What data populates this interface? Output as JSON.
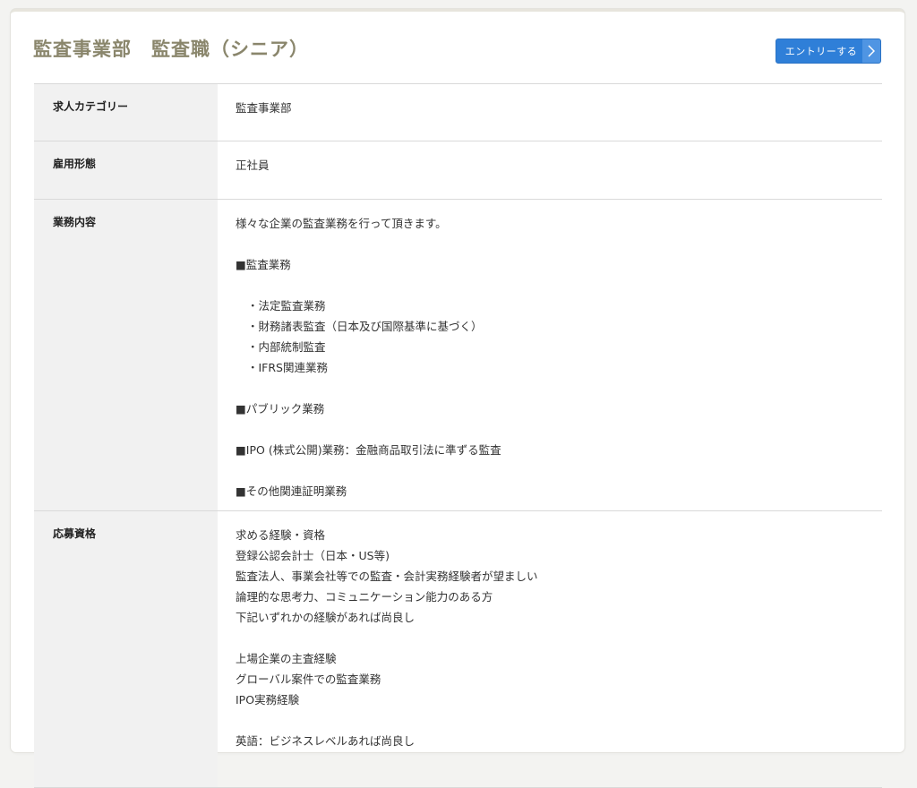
{
  "page": {
    "title": "監査事業部　監査職（シニア）",
    "entry_button_label": "エントリーする",
    "accent_color": "#2f7fd8",
    "title_color": "#8a866c"
  },
  "rows": [
    {
      "label": "求人カテゴリー",
      "value": "監査事業部"
    },
    {
      "label": "雇用形態",
      "value": "正社員"
    },
    {
      "label": "業務内容",
      "intro": "様々な企業の監査業務を行って頂きます。",
      "section1": "■監査業務",
      "items": [
        "・法定監査業務",
        "・財務諸表監査（日本及び国際基準に基づく）",
        "・内部統制監査",
        "・IFRS関連業務"
      ],
      "section2": "■パブリック業務",
      "section3": "■IPO (株式公開)業務：金融商品取引法に準ずる監査",
      "section4": "■その他関連証明業務"
    },
    {
      "label": "応募資格",
      "lines": [
        "求める経験・資格",
        "登録公認会計士（日本・US等)",
        "監査法人、事業会社等での監査・会計実務経験者が望ましい",
        "論理的な思考力、コミュニケーション能力のある方",
        "下記いずれかの経験があれば尚良し"
      ],
      "lines2": [
        "上場企業の主査経験",
        "グローバル案件での監査業務",
        "IPO実務経験"
      ],
      "line3": "英語：ビジネスレベルあれば尚良し"
    }
  ]
}
